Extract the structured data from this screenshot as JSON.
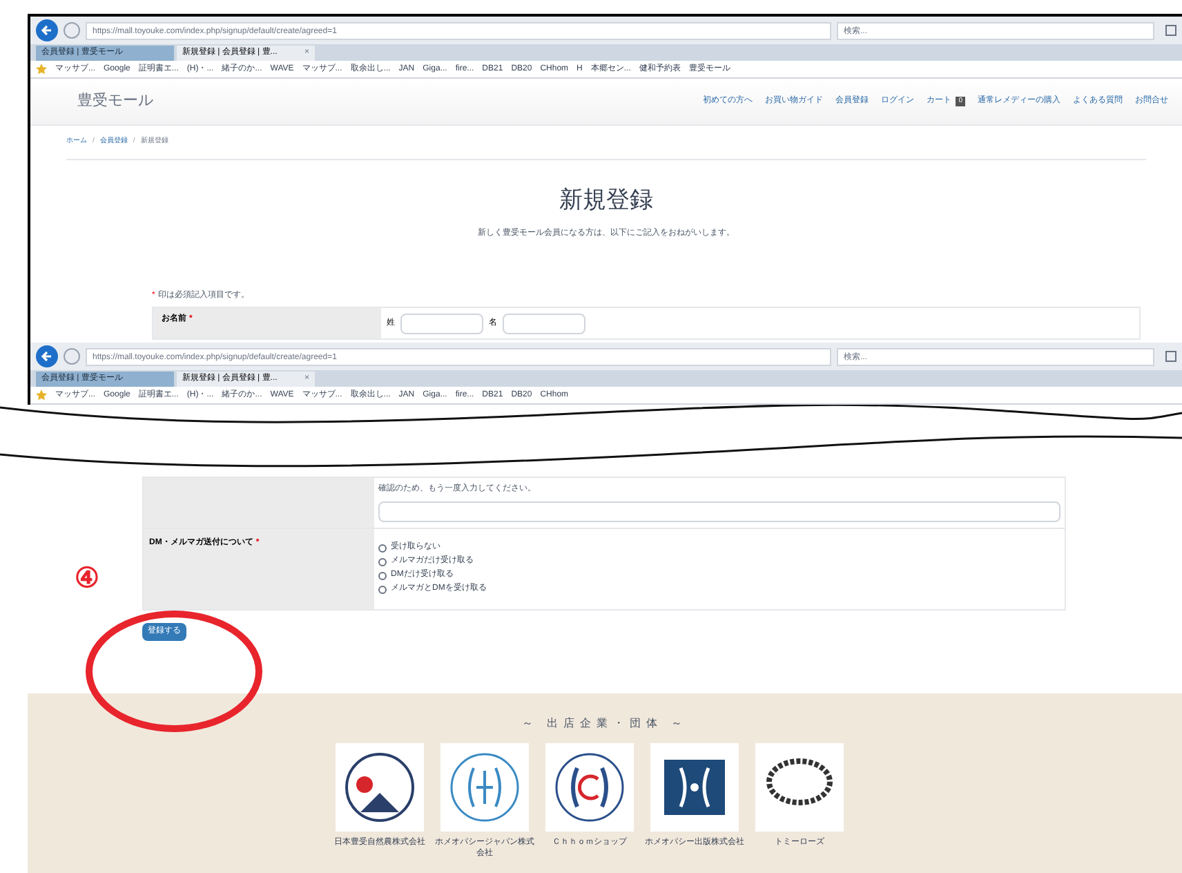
{
  "top_browser": {
    "url": "https://mall.toyouke.com/index.php/signup/default/create/agreed=1",
    "search_placeholder": "検索...",
    "tabs": [
      {
        "label": "会員登録 | 豊受モール",
        "selected": false
      },
      {
        "label": "新規登録 | 会員登録 | 豊...",
        "selected": true,
        "close": "×"
      }
    ],
    "bookmarks": [
      "マッサブ...",
      "Google",
      "証明書エ...",
      "(H)・...",
      "緒子のか...",
      "WAVE",
      "マッサブ...",
      "取余出し...",
      "JAN",
      "Giga...",
      "fire...",
      "DB21",
      "DB20",
      "CHhom",
      "H",
      "本郷セン...",
      "健和予約表",
      "豊受モール"
    ]
  },
  "site": {
    "logo": "豊受モール",
    "nav": [
      {
        "label": "初めての方へ"
      },
      {
        "label": "お買い物ガイド"
      },
      {
        "label": "会員登録"
      },
      {
        "label": "ログイン"
      },
      {
        "label": "カート",
        "badge": "0"
      },
      {
        "label": "通常レメディーの購入"
      },
      {
        "label": "よくある質問"
      },
      {
        "label": "お問合せ"
      }
    ],
    "breadcrumb": [
      "ホーム",
      "会員登録",
      "新規登録"
    ],
    "breadcrumb_separator": "/",
    "title": "新規登録",
    "intro": "新しく豊受モール会員になる方は、以下にご記入をおねがいします。",
    "required_mark": "*",
    "required_note": "印は必須記入項目です。",
    "name_row": {
      "label": "お名前",
      "required": true,
      "fields": [
        "姓",
        "名"
      ]
    }
  },
  "second_browser": {
    "url": "https://mall.toyouke.com/index.php/signup/default/create/agreed=1",
    "search_placeholder": "検索...",
    "tabs": [
      {
        "label": "会員登録 | 豊受モール",
        "selected": false
      },
      {
        "label": "新規登録 | 会員登録 | 豊...",
        "selected": true,
        "close": "×"
      }
    ],
    "bookmarks": [
      "マッサブ...",
      "Google",
      "証明書エ...",
      "(H)・...",
      "緒子のか...",
      "WAVE",
      "マッサブ...",
      "取余出し...",
      "JAN",
      "Giga...",
      "fire...",
      "DB21",
      "DB20",
      "CHhom"
    ]
  },
  "form": {
    "confirm_hint": "確認のため、もう一度入力してください。",
    "dm_label": "DM・メルマガ送付について",
    "dm_required": true,
    "options": [
      {
        "label": "受け取らない",
        "selected": false
      },
      {
        "label": "メルマガだけ受け取る",
        "selected": false
      },
      {
        "label": "DMだけ受け取る",
        "selected": false
      },
      {
        "label": "メルマガとDMを受け取る",
        "selected": false
      }
    ],
    "submit": "登録する"
  },
  "annotation": {
    "step": "④"
  },
  "footer": {
    "heading": "～ 出店企業・団体 ～",
    "companies": [
      {
        "kind": "farm",
        "name": "日本豊受自然農株式会社"
      },
      {
        "kind": "hj",
        "name": "ホメオパシージャパン株式会社"
      },
      {
        "kind": "ch",
        "name": "Ｃｈｈｏｍショップ"
      },
      {
        "kind": "book",
        "name": "ホメオパシー出版株式会社"
      },
      {
        "kind": "rose",
        "name": "トミーローズ"
      }
    ]
  }
}
